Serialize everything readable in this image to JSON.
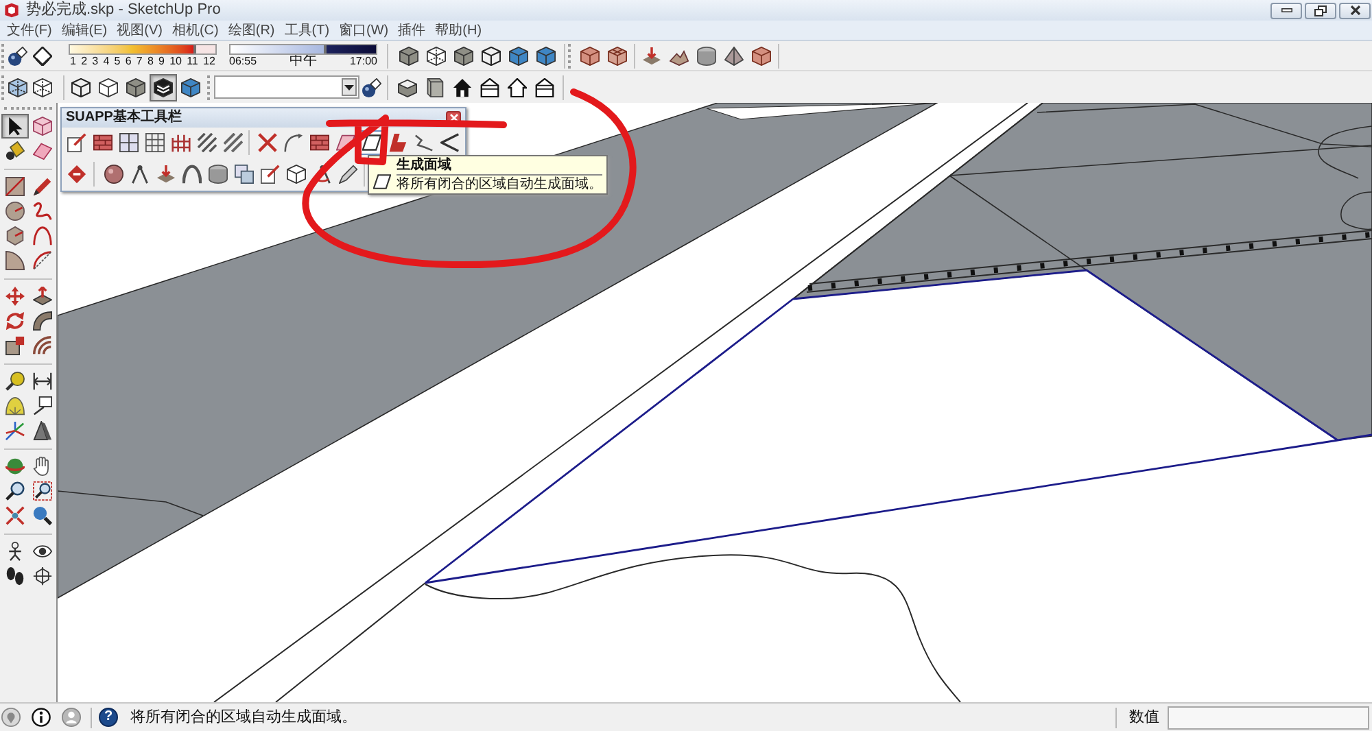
{
  "window": {
    "title": "势必完成.skp - SketchUp Pro"
  },
  "menu": [
    "文件(F)",
    "编辑(E)",
    "视图(V)",
    "相机(C)",
    "绘图(R)",
    "工具(T)",
    "窗口(W)",
    "插件",
    "帮助(H)"
  ],
  "shadow_toolbar": {
    "date_slider": {
      "level": 0.87,
      "labels": [
        "1",
        "2",
        "3",
        "4",
        "5",
        "6",
        "7",
        "8",
        "9",
        "10",
        "11",
        "12"
      ]
    },
    "time_slider": {
      "level": 0.66,
      "start_label": "06:55",
      "middle_label": "中午",
      "end_label": "17:00"
    }
  },
  "style_toolbar": {
    "buttons": [
      {
        "selected": false
      },
      {
        "selected": false
      },
      {
        "selected": false
      },
      {
        "selected": false
      },
      {
        "selected": false
      },
      {
        "selected": true
      },
      {
        "selected": false
      }
    ]
  },
  "left_toolbar": {
    "tools": [
      {
        "selected": true
      },
      {
        "selected": false
      },
      {
        "selected": false
      },
      {
        "selected": false
      },
      {
        "selected": false
      },
      {
        "selected": false
      },
      {
        "selected": false
      },
      {
        "selected": false
      },
      {
        "selected": false
      },
      {
        "selected": false
      },
      {
        "selected": false
      },
      {
        "selected": false
      },
      {
        "selected": false
      },
      {
        "selected": false
      },
      {
        "selected": false
      },
      {
        "selected": false
      },
      {
        "selected": false
      },
      {
        "selected": false
      },
      {
        "selected": false
      },
      {
        "selected": false
      },
      {
        "selected": false
      },
      {
        "selected": false
      },
      {
        "selected": false
      },
      {
        "selected": false
      },
      {
        "selected": false
      },
      {
        "selected": false
      },
      {
        "selected": false
      },
      {
        "selected": false
      },
      {
        "selected": false
      },
      {
        "selected": false
      },
      {
        "selected": false
      },
      {
        "selected": false
      },
      {
        "selected": false
      },
      {
        "selected": false
      }
    ]
  },
  "suapp_toolbar": {
    "title": "SUAPP基本工具栏",
    "row_1": [
      {
        "highlighted": false
      },
      {
        "highlighted": false
      },
      {
        "highlighted": false
      },
      {
        "highlighted": false
      },
      {
        "highlighted": false
      },
      {
        "highlighted": false
      },
      {
        "highlighted": false
      },
      {
        "highlighted": false
      },
      {
        "highlighted": false
      },
      {
        "highlighted": false
      },
      {
        "highlighted": false
      },
      {
        "highlighted": true
      },
      {
        "highlighted": false
      },
      {
        "highlighted": false
      },
      {
        "highlighted": false
      }
    ]
  },
  "tooltip": {
    "title": "生成面域",
    "description": "将所有闭合的区域自动生成面域。"
  },
  "status_bar": {
    "help_mark": "?",
    "message": "将所有闭合的区域自动生成面域。",
    "measurements_label": "数值"
  }
}
